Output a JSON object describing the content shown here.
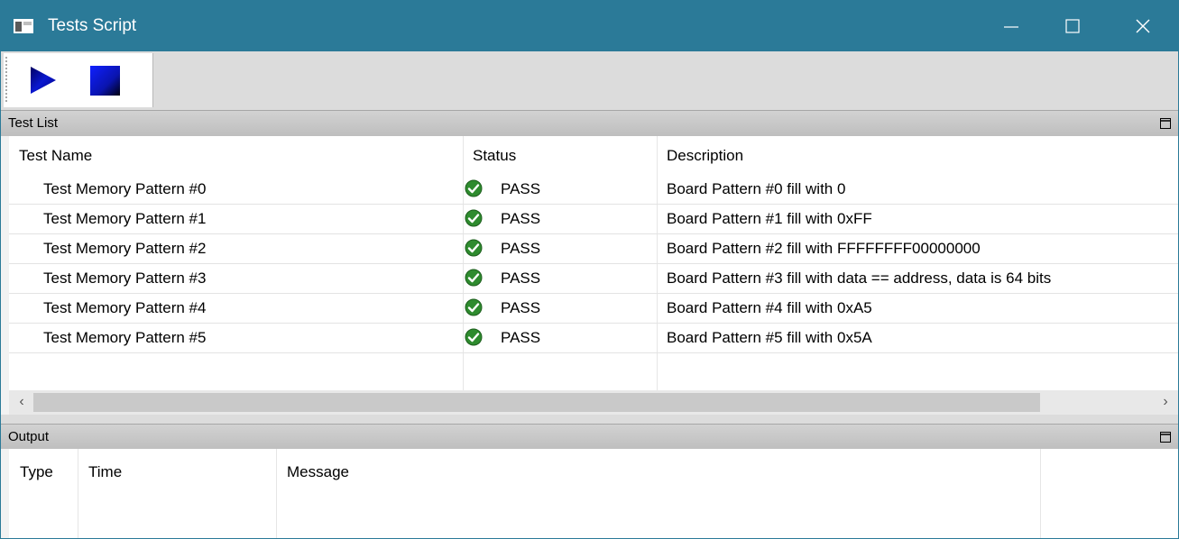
{
  "window": {
    "title": "Tests Script",
    "titlebar_color": "#2b7a98",
    "controls": [
      "minimize-icon",
      "maximize-icon",
      "close-icon"
    ]
  },
  "toolbar": {
    "buttons": [
      {
        "name": "run",
        "icon": "play-icon",
        "color": "#0a1ad6"
      },
      {
        "name": "stop",
        "icon": "stop-icon",
        "color": "#0a1ad6"
      }
    ]
  },
  "test_list": {
    "title": "Test List",
    "columns": [
      "Test Name",
      "Status",
      "Description"
    ],
    "rows": [
      {
        "name": "Test Memory Pattern #0",
        "status": "PASS",
        "description": "Board Pattern #0 fill with 0"
      },
      {
        "name": "Test Memory Pattern #1",
        "status": "PASS",
        "description": "Board Pattern #1 fill with 0xFF"
      },
      {
        "name": "Test Memory Pattern #2",
        "status": "PASS",
        "description": "Board Pattern #2 fill with FFFFFFFF00000000"
      },
      {
        "name": "Test Memory Pattern #3",
        "status": "PASS",
        "description": "Board Pattern #3 fill with data == address, data is 64 bits"
      },
      {
        "name": "Test Memory Pattern #4",
        "status": "PASS",
        "description": "Board Pattern #4 fill with 0xA5"
      },
      {
        "name": "Test Memory Pattern #5",
        "status": "PASS",
        "description": "Board Pattern #5 fill with 0x5A"
      }
    ],
    "status_icon": "check-circle-icon",
    "status_color": "#2e8b2e"
  },
  "output": {
    "title": "Output",
    "columns": [
      "Type",
      "Time",
      "Message"
    ]
  }
}
